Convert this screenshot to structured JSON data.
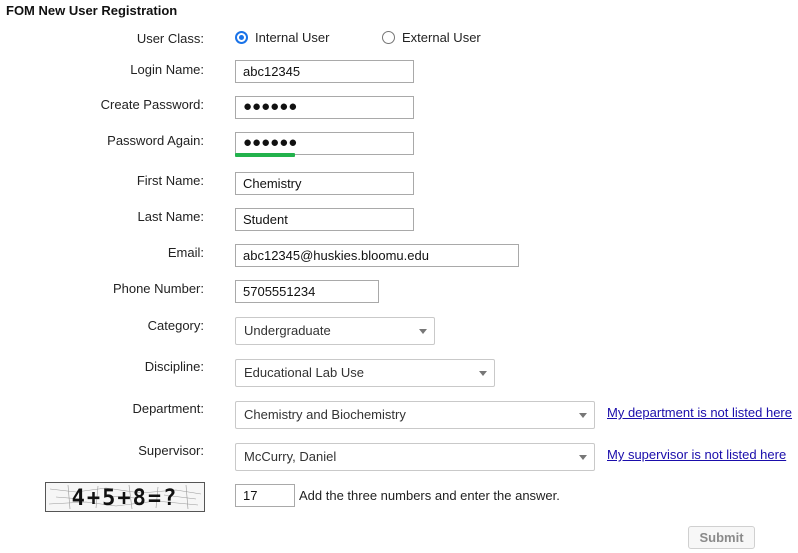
{
  "form": {
    "title": "FOM New User Registration",
    "labels": {
      "user_class": "User Class:",
      "login_name": "Login Name:",
      "create_password": "Create Password:",
      "password_again": "Password Again:",
      "first_name": "First Name:",
      "last_name": "Last Name:",
      "email": "Email:",
      "phone": "Phone Number:",
      "category": "Category:",
      "discipline": "Discipline:",
      "department": "Department:",
      "supervisor": "Supervisor:"
    },
    "user_class": {
      "options": [
        "Internal User",
        "External User"
      ],
      "selected": "Internal User"
    },
    "values": {
      "login_name": "abc12345",
      "create_password": "●●●●●●",
      "password_again": "●●●●●●",
      "first_name": "Chemistry",
      "last_name": "Student",
      "email": "abc12345@huskies.bloomu.edu",
      "phone": "5705551234",
      "category": "Undergraduate",
      "discipline": "Educational Lab Use",
      "department": "Chemistry and Biochemistry",
      "supervisor": "McCurry, Daniel",
      "captcha_answer": "17"
    },
    "links": {
      "department_not_listed": "My department is not listed here",
      "supervisor_not_listed": "My supervisor is not listed here"
    },
    "captcha": {
      "text": "4+5+8=?",
      "hint": "Add the three numbers and enter the answer."
    },
    "submit_label": "Submit",
    "colors": {
      "radio_accent": "#1a73e8",
      "password_strength": "#22b24c",
      "link": "#1a0dab"
    }
  }
}
